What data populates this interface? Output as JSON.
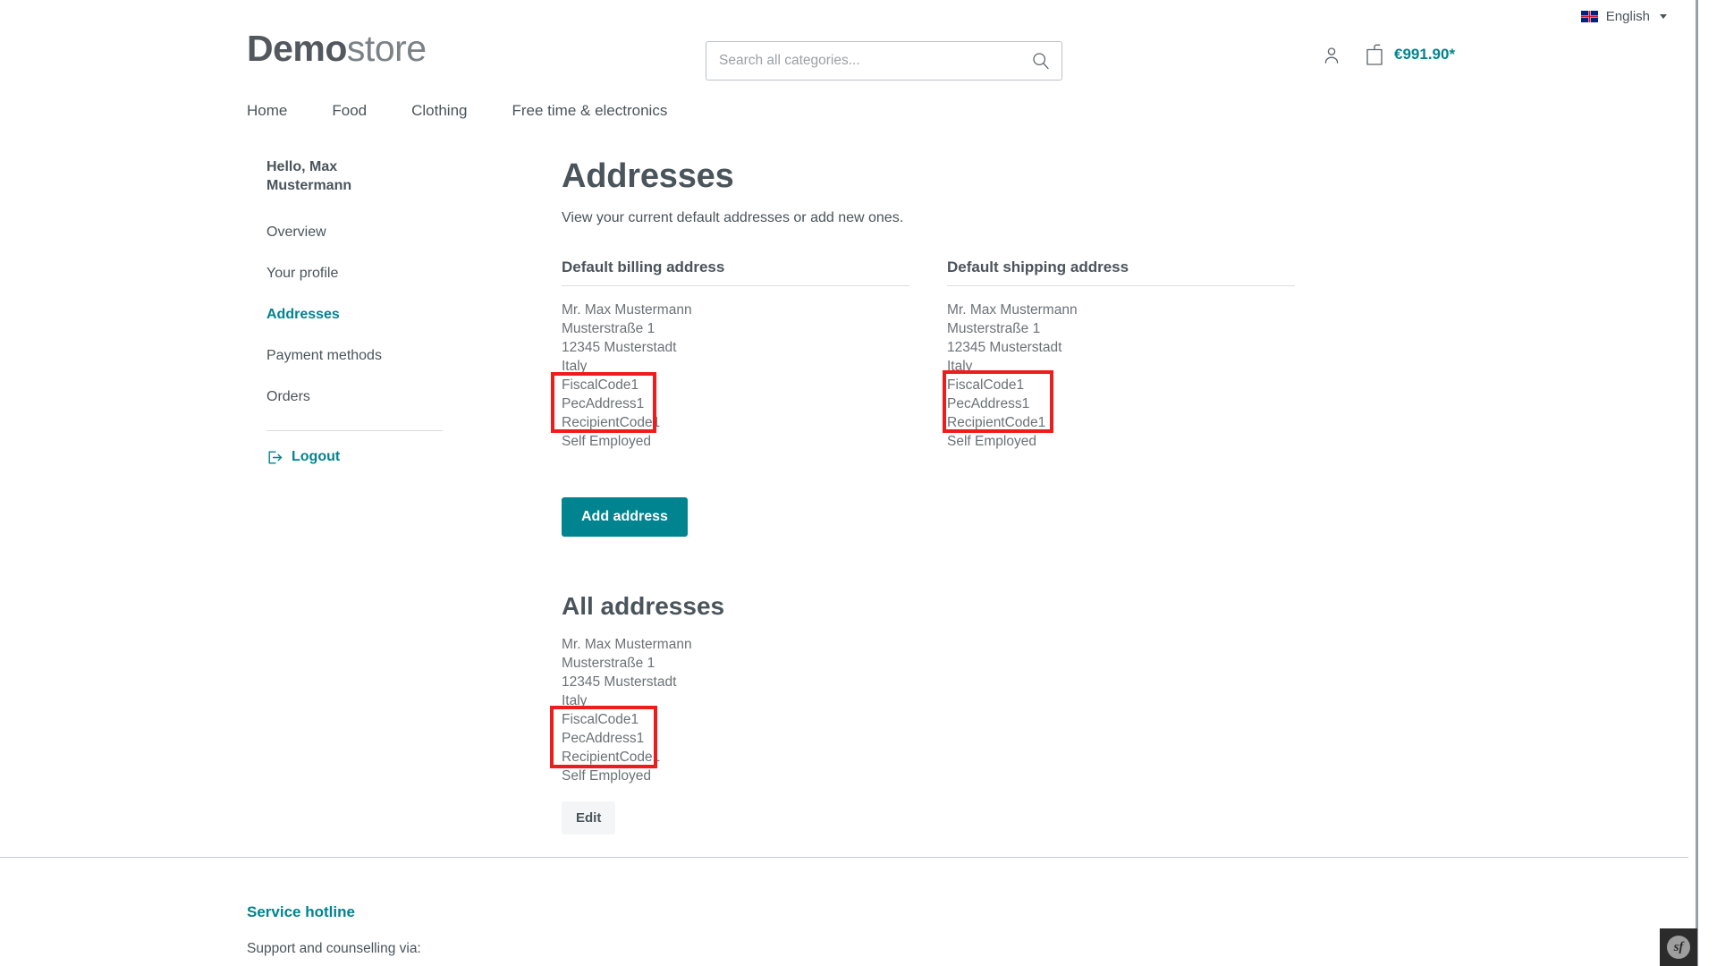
{
  "topbar": {
    "language": "English",
    "flag_icon": "uk-flag-icon",
    "caret_icon": "chevron-down-icon"
  },
  "header": {
    "logo_bold": "Demo",
    "logo_light": "store",
    "search": {
      "placeholder": "Search all categories...",
      "value": "",
      "icon": "search-icon"
    },
    "account_icon": "user-icon",
    "cart_icon": "shopping-bag-icon",
    "cart_total": "€991.90*"
  },
  "mainnav": {
    "items": [
      {
        "label": "Home"
      },
      {
        "label": "Food"
      },
      {
        "label": "Clothing"
      },
      {
        "label": "Free time & electronics"
      }
    ]
  },
  "sidebar": {
    "greeting": "Hello, Max Mustermann",
    "items": [
      {
        "label": "Overview",
        "active": false
      },
      {
        "label": "Your profile",
        "active": false
      },
      {
        "label": "Addresses",
        "active": true
      },
      {
        "label": "Payment methods",
        "active": false
      },
      {
        "label": "Orders",
        "active": false
      }
    ],
    "logout": {
      "label": "Logout",
      "icon": "logout-icon"
    }
  },
  "main": {
    "title": "Addresses",
    "subtitle": "View your current default addresses or add new ones.",
    "billing": {
      "heading": "Default billing address",
      "lines": [
        "Mr. Max Mustermann",
        "Musterstraße 1",
        "12345 Musterstadt",
        "Italy"
      ],
      "highlighted_lines": [
        "FiscalCode1",
        "PecAddress1",
        "RecipientCode1",
        "Self Employed"
      ]
    },
    "shipping": {
      "heading": "Default shipping address",
      "lines": [
        "Mr. Max Mustermann",
        "Musterstraße 1",
        "12345 Musterstadt",
        "Italy"
      ],
      "highlighted_lines": [
        "FiscalCode1",
        "PecAddress1",
        "RecipientCode1",
        "Self Employed"
      ]
    },
    "add_address_label": "Add address",
    "all_addresses": {
      "heading": "All addresses",
      "lines": [
        "Mr. Max Mustermann",
        "Musterstraße 1",
        "12345 Musterstadt",
        "Italy"
      ],
      "highlighted_lines": [
        "FiscalCode1",
        "PecAddress1",
        "RecipientCode1",
        "Self Employed"
      ],
      "edit_label": "Edit"
    }
  },
  "footer": {
    "heading": "Service hotline",
    "text": "Support and counselling via:"
  },
  "debug": {
    "symfony_label": "sf"
  },
  "colors": {
    "accent": "#008490",
    "text": "#4a545b",
    "muted": "#6b7277",
    "annotation": "#ee1c1c",
    "border": "#d9dde1"
  }
}
